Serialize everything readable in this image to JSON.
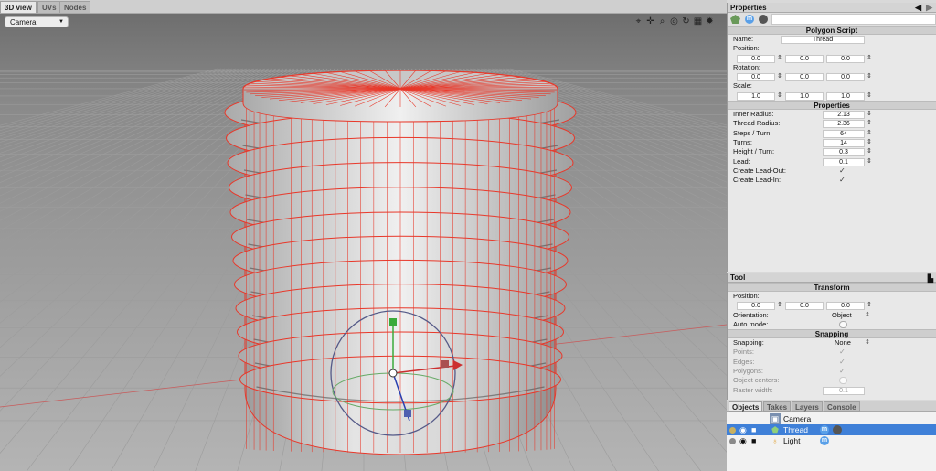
{
  "view_tabs": [
    "3D view",
    "UVs",
    "Nodes"
  ],
  "viewport": {
    "camera_select": "Camera",
    "tool_icons": [
      "crosshair-icon",
      "move-icon",
      "zoom-icon",
      "focus-icon",
      "rotate-icon",
      "layout-icon",
      "settings-icon"
    ],
    "tool_glyphs": [
      "⌖",
      "✛",
      "⌕",
      "◎",
      "↻",
      "▦",
      "✹"
    ],
    "mesh_color": "#e8382a",
    "background_top": "#7a7a7a",
    "background_bottom": "#b0b0b0"
  },
  "properties": {
    "title": "Properties",
    "script_header": "Polygon Script",
    "name_label": "Name:",
    "name_value": "Thread",
    "position_label": "Position:",
    "position": [
      "0.0",
      "0.0",
      "0.0"
    ],
    "rotation_label": "Rotation:",
    "rotation": [
      "0.0",
      "0.0",
      "0.0"
    ],
    "scale_label": "Scale:",
    "scale": [
      "1.0",
      "1.0",
      "1.0"
    ],
    "props_header": "Properties",
    "fields": [
      {
        "label": "Inner Radius:",
        "value": "2.13"
      },
      {
        "label": "Thread Radius:",
        "value": "2.36"
      },
      {
        "label": "Steps / Turn:",
        "value": "64"
      },
      {
        "label": "Turns:",
        "value": "14"
      },
      {
        "label": "Height / Turn:",
        "value": "0.3"
      },
      {
        "label": "Lead:",
        "value": "0.1"
      }
    ],
    "checks": [
      {
        "label": "Create Lead-Out:",
        "checked": true
      },
      {
        "label": "Create Lead-In:",
        "checked": true
      }
    ]
  },
  "tool": {
    "title": "Tool",
    "transform_header": "Transform",
    "position_label": "Position:",
    "position": [
      "0.0",
      "0.0",
      "0.0"
    ],
    "orientation_label": "Orientation:",
    "orientation_value": "Object",
    "auto_mode_label": "Auto mode:",
    "snapping_header": "Snapping",
    "snapping_label": "Snapping:",
    "snapping_value": "None",
    "points_label": "Points:",
    "edges_label": "Edges:",
    "polygons_label": "Polygons:",
    "object_centers_label": "Object centers:",
    "raster_label": "Raster width:",
    "raster_value": "0.1"
  },
  "object_tabs": [
    "Objects",
    "Takes",
    "Layers",
    "Console"
  ],
  "objects": [
    {
      "name": "Camera",
      "icon": "camera-object-icon",
      "selected": false
    },
    {
      "name": "Thread",
      "icon": "thread-object-icon",
      "selected": true
    },
    {
      "name": "Light",
      "icon": "light-object-icon",
      "selected": false
    }
  ]
}
